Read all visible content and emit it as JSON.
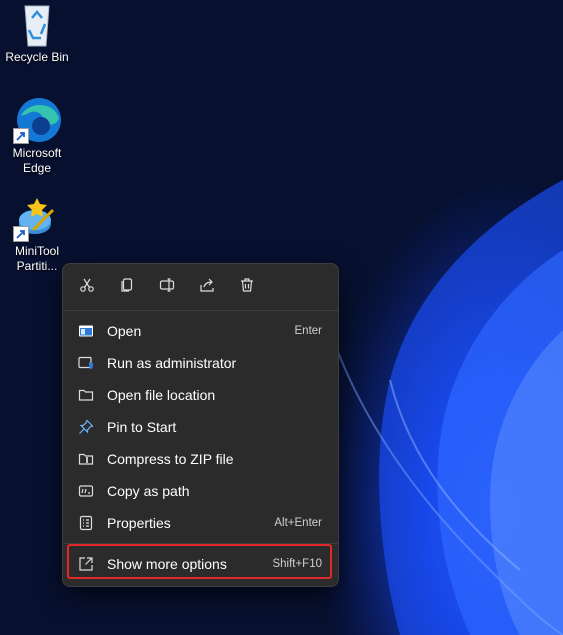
{
  "desktop": {
    "icons": [
      {
        "label": "Recycle Bin"
      },
      {
        "label_line1": "Microsoft",
        "label_line2": "Edge"
      },
      {
        "label_line1": "MiniTool",
        "label_line2": "Partiti..."
      }
    ]
  },
  "context_menu": {
    "toolbar": [
      "cut-icon",
      "copy-icon",
      "rename-icon",
      "share-icon",
      "delete-icon"
    ],
    "items": [
      {
        "label": "Open",
        "shortcut": "Enter"
      },
      {
        "label": "Run as administrator",
        "shortcut": ""
      },
      {
        "label": "Open file location",
        "shortcut": ""
      },
      {
        "label": "Pin to Start",
        "shortcut": ""
      },
      {
        "label": "Compress to ZIP file",
        "shortcut": ""
      },
      {
        "label": "Copy as path",
        "shortcut": ""
      },
      {
        "label": "Properties",
        "shortcut": "Alt+Enter"
      },
      {
        "label": "Show more options",
        "shortcut": "Shift+F10"
      }
    ],
    "highlight_color": "#e0282a"
  }
}
